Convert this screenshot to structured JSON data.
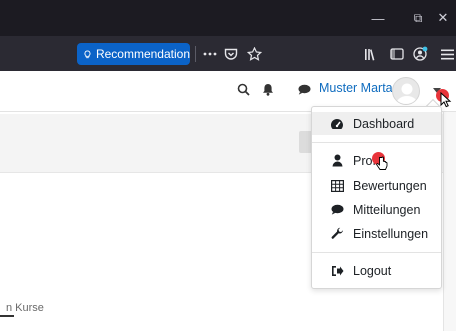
{
  "browser": {
    "window_controls": {
      "minimize": "—",
      "restore": "⧉",
      "close": "✕"
    },
    "recommendation_label": "Recommendation",
    "toolbar_icons": [
      "more-icon",
      "pocket-icon",
      "bookmark-star-icon",
      "library-icon",
      "sidebar-icon",
      "account-icon",
      "menu-icon"
    ]
  },
  "navbar": {
    "username": "Muster Marta"
  },
  "dropdown": {
    "items": [
      {
        "label": "Dashboard",
        "icon": "tachometer-icon"
      },
      {
        "label": "Profil",
        "icon": "user-icon"
      },
      {
        "label": "Bewertungen",
        "icon": "table-icon"
      },
      {
        "label": "Mitteilungen",
        "icon": "comment-icon"
      },
      {
        "label": "Einstellungen",
        "icon": "wrench-icon"
      },
      {
        "label": "Logout",
        "icon": "sign-out-icon"
      }
    ]
  },
  "content": {
    "partial_text": "n Kurse"
  },
  "colors": {
    "titlebar": "#1c1b22",
    "toolbar": "#2b2a33",
    "recommendation": "#0b63c8",
    "link": "#0f6cbf",
    "cursor_dot": "#e8343a"
  }
}
